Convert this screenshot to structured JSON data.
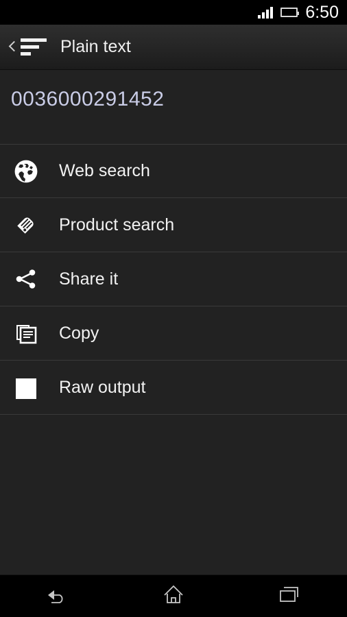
{
  "status_bar": {
    "signal_icon": "signal-bars-icon",
    "signal_bars": 4,
    "battery_icon": "battery-icon",
    "battery_color": "#8cc63e",
    "time": "6:50"
  },
  "action_bar": {
    "up_icon": "back-chevron-icon",
    "app_icon": "list-lines-icon",
    "title": "Plain text"
  },
  "result": {
    "barcode_value": "0036000291452",
    "value_color": "#c9cce6"
  },
  "actions": [
    {
      "icon": "globe-icon",
      "label": "Web search"
    },
    {
      "icon": "price-tag-icon",
      "label": "Product search"
    },
    {
      "icon": "share-icon",
      "label": "Share it"
    },
    {
      "icon": "copy-icon",
      "label": "Copy"
    },
    {
      "icon": "square-icon",
      "label": "Raw output"
    }
  ],
  "nav_bar": {
    "back": "back-icon",
    "home": "home-icon",
    "recents": "recent-apps-icon"
  },
  "theme": {
    "background": "#222222",
    "divider": "#3a3a3a",
    "text": "#f2f2f2",
    "black": "#000000"
  }
}
